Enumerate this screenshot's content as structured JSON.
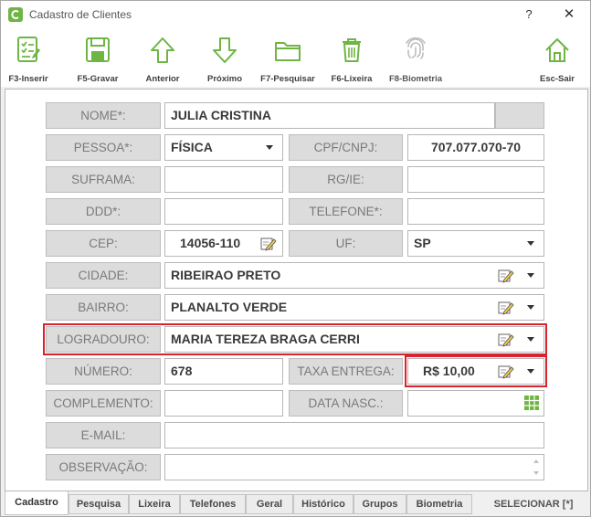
{
  "window": {
    "title": "Cadastro de Clientes",
    "help": "?",
    "close": "✕"
  },
  "toolbar": {
    "insert": "F3-Inserir",
    "save": "F5-Gravar",
    "previous": "Anterior",
    "next": "Próximo",
    "search": "F7-Pesquisar",
    "trash": "F6-Lixeira",
    "biometry": "F8-Biometria",
    "exit": "Esc-Sair"
  },
  "form": {
    "nome_label": "NOME*:",
    "nome_value": "JULIA CRISTINA",
    "pessoa_label": "PESSOA*:",
    "pessoa_value": "FÍSICA",
    "cpf_label": "CPF/CNPJ:",
    "cpf_value": "707.077.070-70",
    "suframa_label": "SUFRAMA:",
    "suframa_value": "",
    "rg_label": "RG/IE:",
    "rg_value": "",
    "ddd_label": "DDD*:",
    "ddd_value": "",
    "telefone_label": "TELEFONE*:",
    "telefone_value": "",
    "cep_label": "CEP:",
    "cep_value": "14056-110",
    "uf_label": "UF:",
    "uf_value": "SP",
    "cidade_label": "CIDADE:",
    "cidade_value": "RIBEIRAO PRETO",
    "bairro_label": "BAIRRO:",
    "bairro_value": "PLANALTO VERDE",
    "logradouro_label": "LOGRADOURO:",
    "logradouro_value": "MARIA TEREZA BRAGA CERRI",
    "numero_label": "NÚMERO:",
    "numero_value": "678",
    "taxa_label": "TAXA ENTREGA:",
    "taxa_value": "R$ 10,00",
    "complemento_label": "COMPLEMENTO:",
    "complemento_value": "",
    "nasc_label": "DATA NASC.:",
    "nasc_value": "",
    "email_label": "E-MAIL:",
    "email_value": "",
    "obs_label": "OBSERVAÇÃO:",
    "obs_value": ""
  },
  "tabs": [
    "Cadastro",
    "Pesquisa",
    "Lixeira",
    "Telefones",
    "Geral",
    "Histórico",
    "Grupos",
    "Biometria"
  ],
  "select_button": "SELECIONAR [*]",
  "colors": {
    "icon_green": "#6fb544",
    "highlight": "#d9232e",
    "label_bg": "#dcdcdc"
  }
}
